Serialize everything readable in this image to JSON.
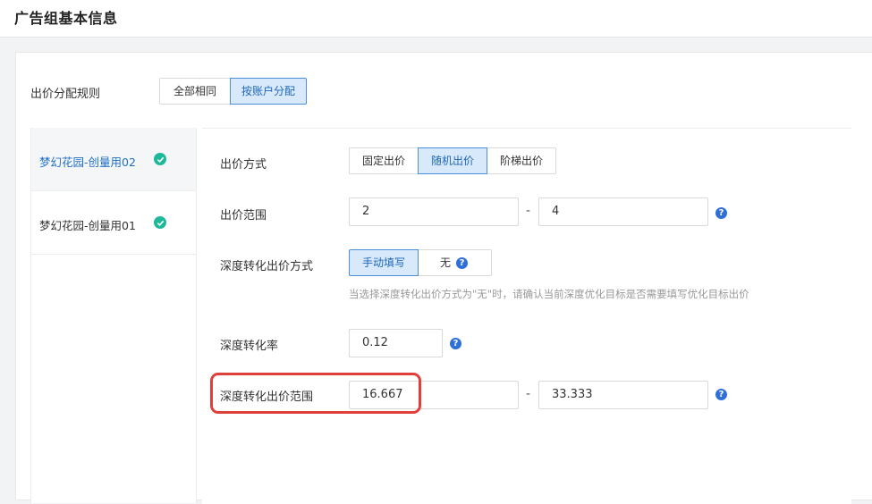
{
  "header": {
    "title": "广告组基本信息"
  },
  "bid_allocation": {
    "label": "出价分配规则",
    "options": [
      "全部相同",
      "按账户分配"
    ],
    "selected": "按账户分配"
  },
  "accounts": [
    {
      "name": "梦幻花园-创量用02",
      "active": true
    },
    {
      "name": "梦幻花园-创量用01",
      "active": false
    }
  ],
  "form": {
    "bid_method": {
      "label": "出价方式",
      "options": [
        "固定出价",
        "随机出价",
        "阶梯出价"
      ],
      "selected": "随机出价"
    },
    "bid_range": {
      "label": "出价范围",
      "min": "2",
      "max": "4",
      "separator": "-"
    },
    "deep_bid_method": {
      "label": "深度转化出价方式",
      "options": [
        "手动填写",
        "无"
      ],
      "selected": "手动填写",
      "hint": "当选择深度转化出价方式为\"无\"时，请确认当前深度优化目标是否需要填写优化目标出价"
    },
    "deep_rate": {
      "label": "深度转化率",
      "value": "0.12"
    },
    "deep_bid_range": {
      "label": "深度转化出价范围",
      "min": "16.667",
      "max": "33.333",
      "separator": "-"
    }
  },
  "icons": {
    "help": "?"
  },
  "colors": {
    "accent": "#1f67b8",
    "check": "#1fb89a",
    "help": "#2f6fd8",
    "highlight": "#e0403a"
  }
}
